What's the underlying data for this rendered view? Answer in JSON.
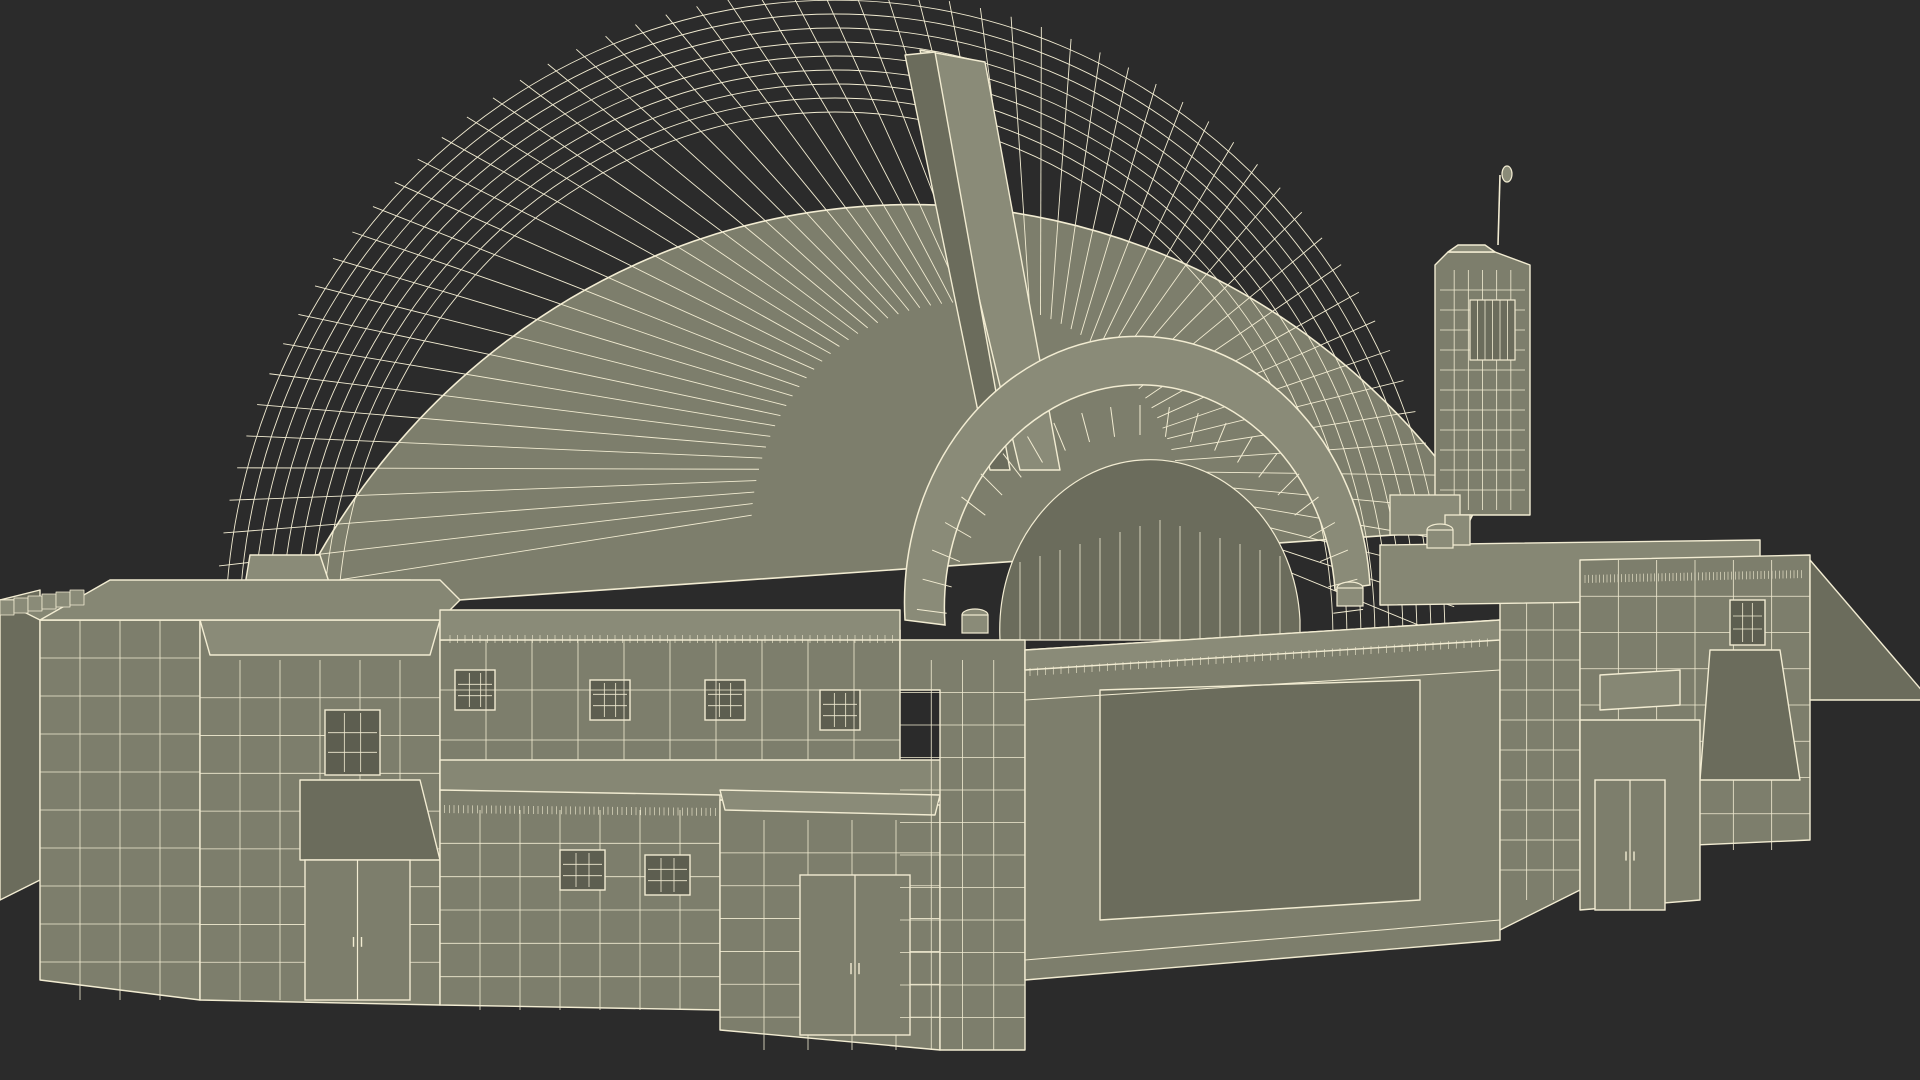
{
  "scene": {
    "subject": "wireframe-building-render",
    "colors": {
      "background": "#2b2b2b",
      "face_main": "#7d7e6c",
      "face_dark": "#6b6c5c",
      "face_light": "#8a8b78",
      "face_roof": "#868774",
      "wire": "#f2ecd2",
      "window": "#5d5e50"
    }
  }
}
